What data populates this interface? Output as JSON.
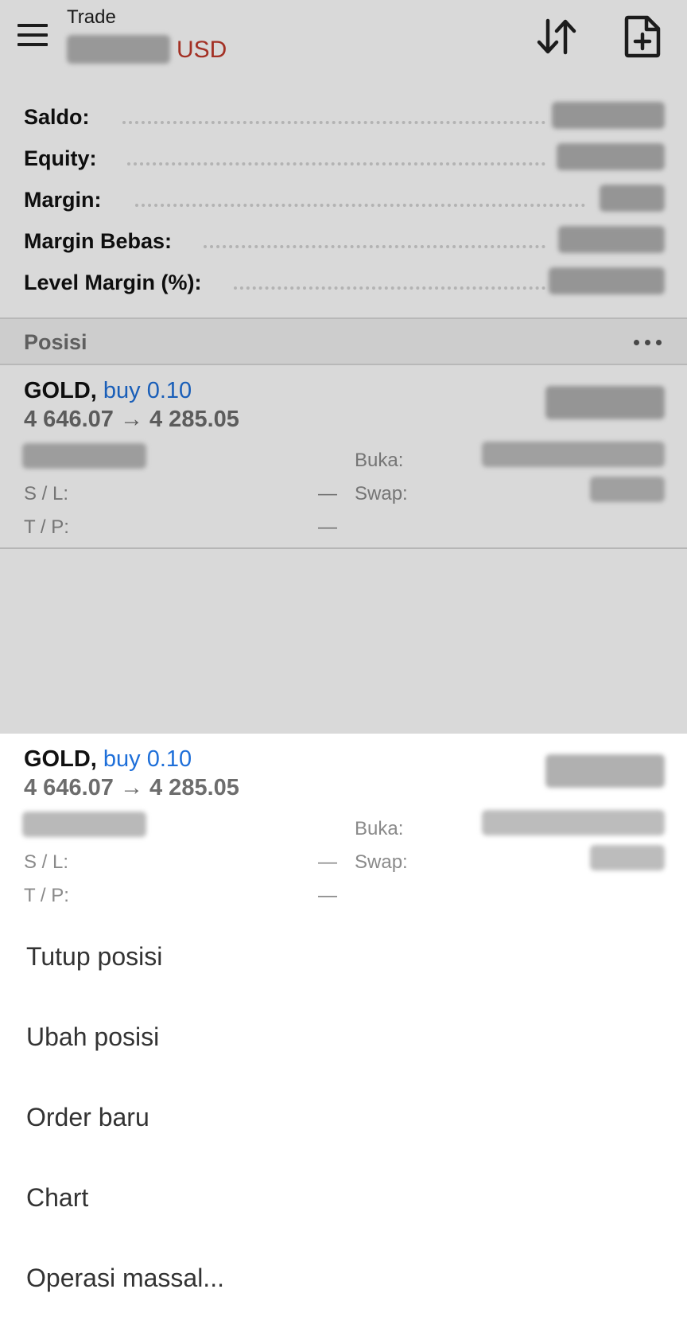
{
  "header": {
    "title": "Trade",
    "currency": "USD"
  },
  "summary": [
    {
      "label": "Saldo:"
    },
    {
      "label": "Equity:"
    },
    {
      "label": "Margin:"
    },
    {
      "label": "Margin Bebas:"
    },
    {
      "label": "Level Margin (%):"
    }
  ],
  "positions_section": {
    "title": "Posisi"
  },
  "position": {
    "symbol": "GOLD,",
    "direction": "buy 0.10",
    "prices": "4 646.07 → 4 285.05",
    "open_label": "Buka:",
    "sl_label": "S / L:",
    "sl_value": "—",
    "tp_label": "T / P:",
    "tp_value": "—",
    "swap_label": "Swap:"
  },
  "context_menu": {
    "items": [
      {
        "label": "Tutup posisi"
      },
      {
        "label": "Ubah posisi"
      },
      {
        "label": "Order baru"
      },
      {
        "label": "Chart"
      },
      {
        "label": "Operasi massal..."
      }
    ]
  },
  "colors": {
    "currency": "#c0392b",
    "direction": "#1e6fd9"
  }
}
